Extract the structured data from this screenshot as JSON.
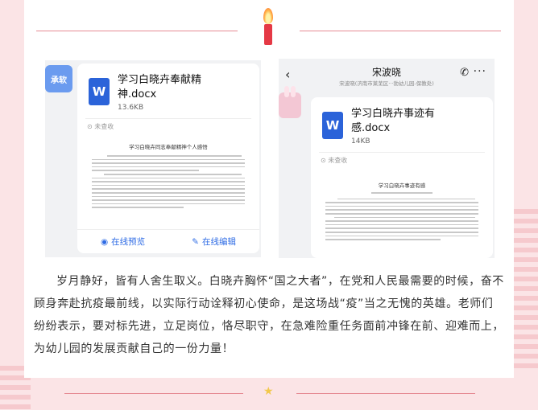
{
  "left_shot": {
    "badge": "承软",
    "file_name": "学习白晓卉奉献精神.docx",
    "file_size": "13.6KB",
    "status": "未查收",
    "doc_title": "学习白晓卉同志奉献精神个人感悟",
    "preview_label": "在线预览",
    "edit_label": "在线编辑"
  },
  "right_shot": {
    "contact_name": "宋波晓",
    "contact_org": "宋波晓(济南市莱芜区···勃幼儿园-保教处)",
    "file_name": "学习白晓卉事迹有感.docx",
    "file_size": "14KB",
    "status": "未查收",
    "doc_title": "学习白晓卉事迹有感"
  },
  "article": {
    "paragraph": "岁月静好，皆有人舍生取义。白晓卉胸怀“国之大者”，在党和人民最需要的时候，奋不顾身奔赴抗疫最前线，以实际行动诠释初心使命，是这场战“疫”当之无愧的英雄。老师们纷纷表示，要对标先进，立足岗位，恪尽职守，在急难险重任务面前冲锋在前、迎难而上，为幼儿园的发展贡献自己的一份力量！"
  },
  "icons": {
    "word": "W",
    "back": "‹",
    "call": "✆",
    "more": "···",
    "eye": "◉",
    "edit": "✎",
    "unchecked": "⊙",
    "star": "★"
  },
  "colors": {
    "accent_pink": "#e58a93",
    "word_blue": "#2b63d9",
    "link_blue": "#2f6ce5"
  }
}
